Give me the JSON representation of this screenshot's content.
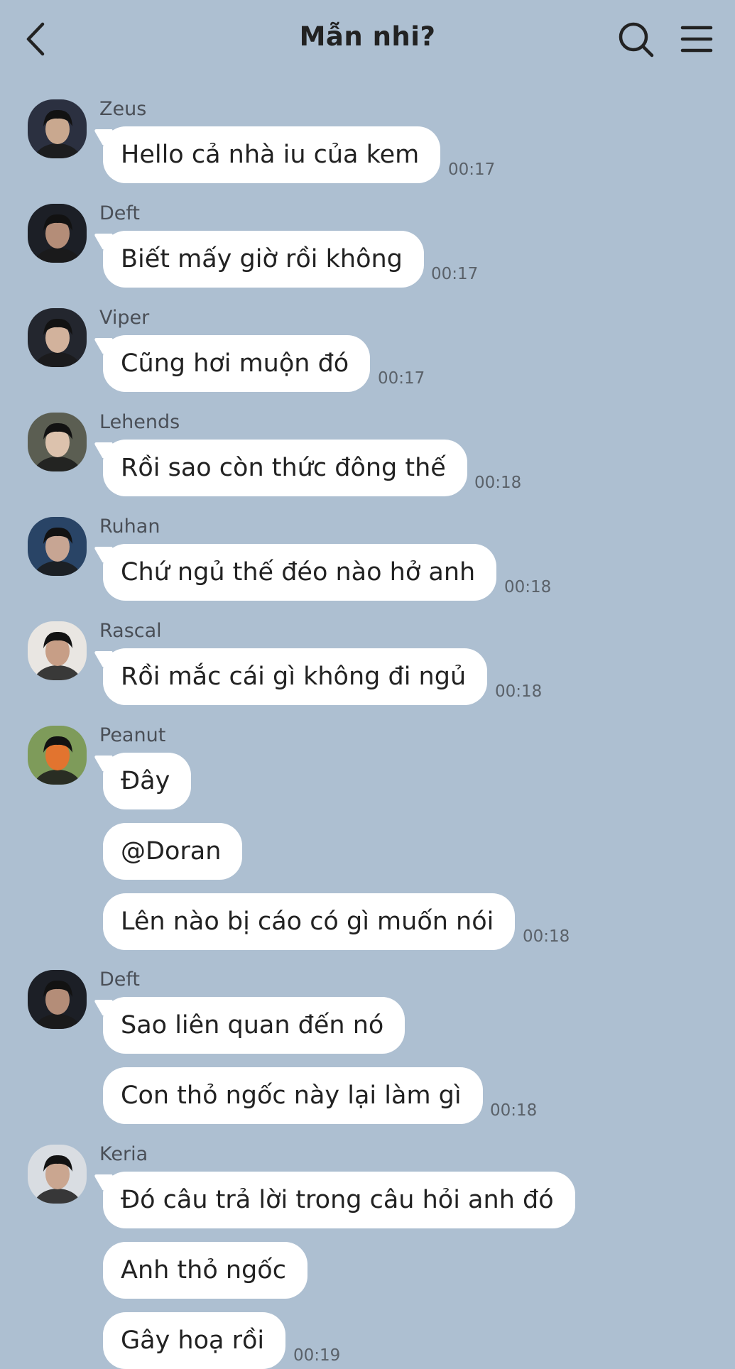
{
  "header": {
    "title": "Mẫn nhi?",
    "back_icon": "chevron-left-icon",
    "search_icon": "search-icon",
    "menu_icon": "hamburger-menu-icon"
  },
  "colors": {
    "background": "#adbfd1",
    "bubble": "#ffffff",
    "text": "#222222",
    "sender": "#4a4f57",
    "time": "#5a6169"
  },
  "groups": [
    {
      "sender": "Zeus",
      "messages": [
        "Hello cả nhà iu của kem"
      ],
      "time": "00:17"
    },
    {
      "sender": "Deft",
      "messages": [
        "Biết mấy giờ rồi không"
      ],
      "time": "00:17"
    },
    {
      "sender": "Viper",
      "messages": [
        "Cũng hơi muộn đó"
      ],
      "time": "00:17"
    },
    {
      "sender": "Lehends",
      "messages": [
        "Rồi sao còn thức đông thế"
      ],
      "time": "00:18"
    },
    {
      "sender": "Ruhan",
      "messages": [
        "Chứ ngủ thế đéo nào hở anh"
      ],
      "time": "00:18"
    },
    {
      "sender": "Rascal",
      "messages": [
        "Rồi mắc cái gì không đi ngủ"
      ],
      "time": "00:18"
    },
    {
      "sender": "Peanut",
      "messages": [
        "Đây",
        "@Doran",
        "Lên nào bị cáo có gì muốn nói"
      ],
      "time": "00:18"
    },
    {
      "sender": "Deft",
      "messages": [
        "Sao liên quan đến nó",
        "Con thỏ ngốc này lại làm gì"
      ],
      "time": "00:18"
    },
    {
      "sender": "Keria",
      "messages": [
        "Đó câu trả lời trong câu hỏi anh đó",
        "Anh thỏ ngốc",
        "Gây hoạ rồi"
      ],
      "time": "00:19"
    }
  ]
}
